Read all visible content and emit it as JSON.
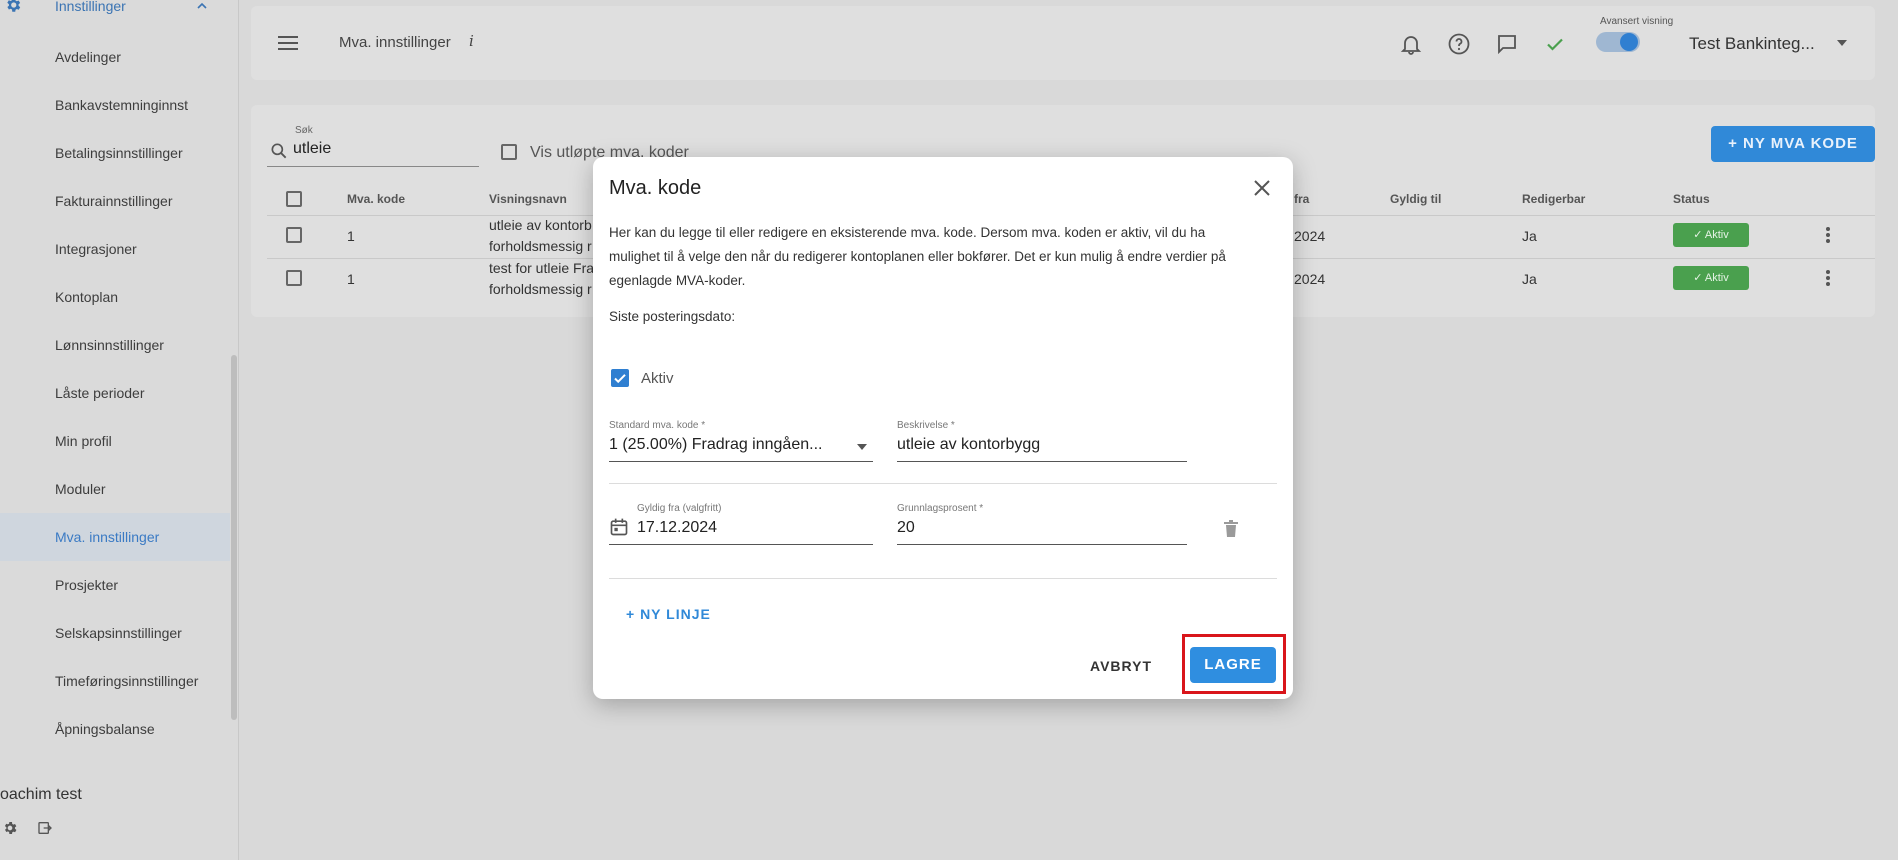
{
  "sidebar": {
    "section_label": "Innstillinger",
    "items": [
      {
        "label": "Avdelinger"
      },
      {
        "label": "Bankavstemninginnst"
      },
      {
        "label": "Betalingsinnstillinger"
      },
      {
        "label": "Fakturainnstillinger"
      },
      {
        "label": "Integrasjoner"
      },
      {
        "label": "Kontoplan"
      },
      {
        "label": "Lønnsinnstillinger"
      },
      {
        "label": "Låste perioder"
      },
      {
        "label": "Min profil"
      },
      {
        "label": "Moduler"
      },
      {
        "label": "Mva. innstillinger"
      },
      {
        "label": "Prosjekter"
      },
      {
        "label": "Selskapsinnstillinger"
      },
      {
        "label": "Timeføringsinnstillinger"
      },
      {
        "label": "Åpningsbalanse"
      }
    ],
    "active_item": "Mva. innstillinger",
    "user_name": "oachim test"
  },
  "topbar": {
    "page_title": "Mva. innstillinger",
    "info_glyph": "i",
    "advanced_view_label": "Avansert visning",
    "advanced_view_on": true,
    "company_name": "Test Bankinteg...",
    "accent": "#2f7fd1"
  },
  "list": {
    "search_label": "Søk",
    "search_value": "utleie",
    "show_expired_label": "Vis utløpte mva. koder",
    "new_button_label": "+ NY MVA KODE",
    "headers": {
      "code": "Mva. kode",
      "display_name": "Visningsnavn",
      "valid_from": "fra",
      "valid_to": "Gyldig til",
      "editable": "Redigerbar",
      "status": "Status"
    },
    "rows": [
      {
        "code": "1",
        "name_line1": "utleie av kontorb",
        "name_line2": "forholdsmessig r",
        "valid_from": "2024",
        "editable": "Ja",
        "status": "Aktiv"
      },
      {
        "code": "1",
        "name_line1": "test for utleie Fra",
        "name_line2": "forholdsmessig r",
        "valid_from": "2024",
        "editable": "Ja",
        "status": "Aktiv"
      }
    ],
    "status_color": "#4aa04e"
  },
  "dialog": {
    "title": "Mva. kode",
    "description": "Her kan du legge til eller redigere en eksisterende mva. kode. Dersom mva. koden er aktiv, vil du ha mulighet til å velge den når du redigerer kontoplanen eller bokfører. Det er kun mulig å endre verdier på egenlagde MVA-koder.",
    "last_posting_label": "Siste posteringsdato:",
    "active_label": "Aktiv",
    "active_checked": true,
    "standard_code_label": "Standard mva. kode *",
    "standard_code_value": "1 (25.00%) Fradrag inngåen...",
    "description_label": "Beskrivelse *",
    "description_value": "utleie av kontorbygg",
    "valid_from_label": "Gyldig fra (valgfritt)",
    "valid_from_value": "17.12.2024",
    "basis_percent_label": "Grunnlagsprosent *",
    "basis_percent_value": "20",
    "new_line_label": "+ NY LINJE",
    "cancel_label": "AVBRYT",
    "save_label": "LAGRE",
    "highlight_color": "#d9151b"
  }
}
